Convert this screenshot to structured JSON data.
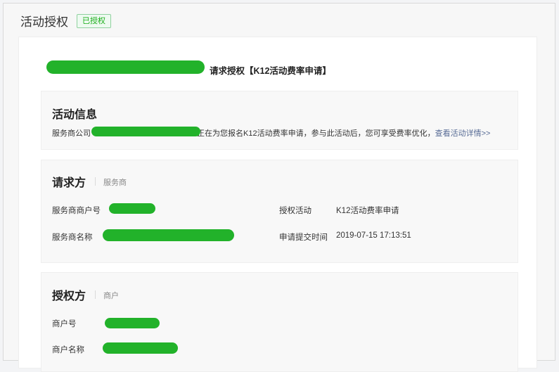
{
  "header": {
    "title": "活动授权",
    "status_badge": "已授权"
  },
  "request": {
    "suffix": "请求授权【K12活动费率申请】"
  },
  "activity_info": {
    "title": "活动信息",
    "text_prefix": "服务商公司",
    "text_middle": "正在为您报名K12活动费率申请，参与此活动后，您可享受费率优化，",
    "link_label": "查看活动详情>>"
  },
  "requester": {
    "title": "请求方",
    "subtitle": "服务商",
    "merchant_no_label": "服务商商户号",
    "name_label": "服务商名称",
    "activity_label": "授权活动",
    "activity_value": "K12活动费率申请",
    "submit_time_label": "申请提交时间",
    "submit_time_value": "2019-07-15 17:13:51"
  },
  "grantor": {
    "title": "授权方",
    "subtitle": "商户",
    "merchant_no_label": "商户号",
    "name_label": "商户名称"
  },
  "colors": {
    "accent": "#1aad19",
    "link": "#576b95",
    "redaction": "#22b22a"
  }
}
